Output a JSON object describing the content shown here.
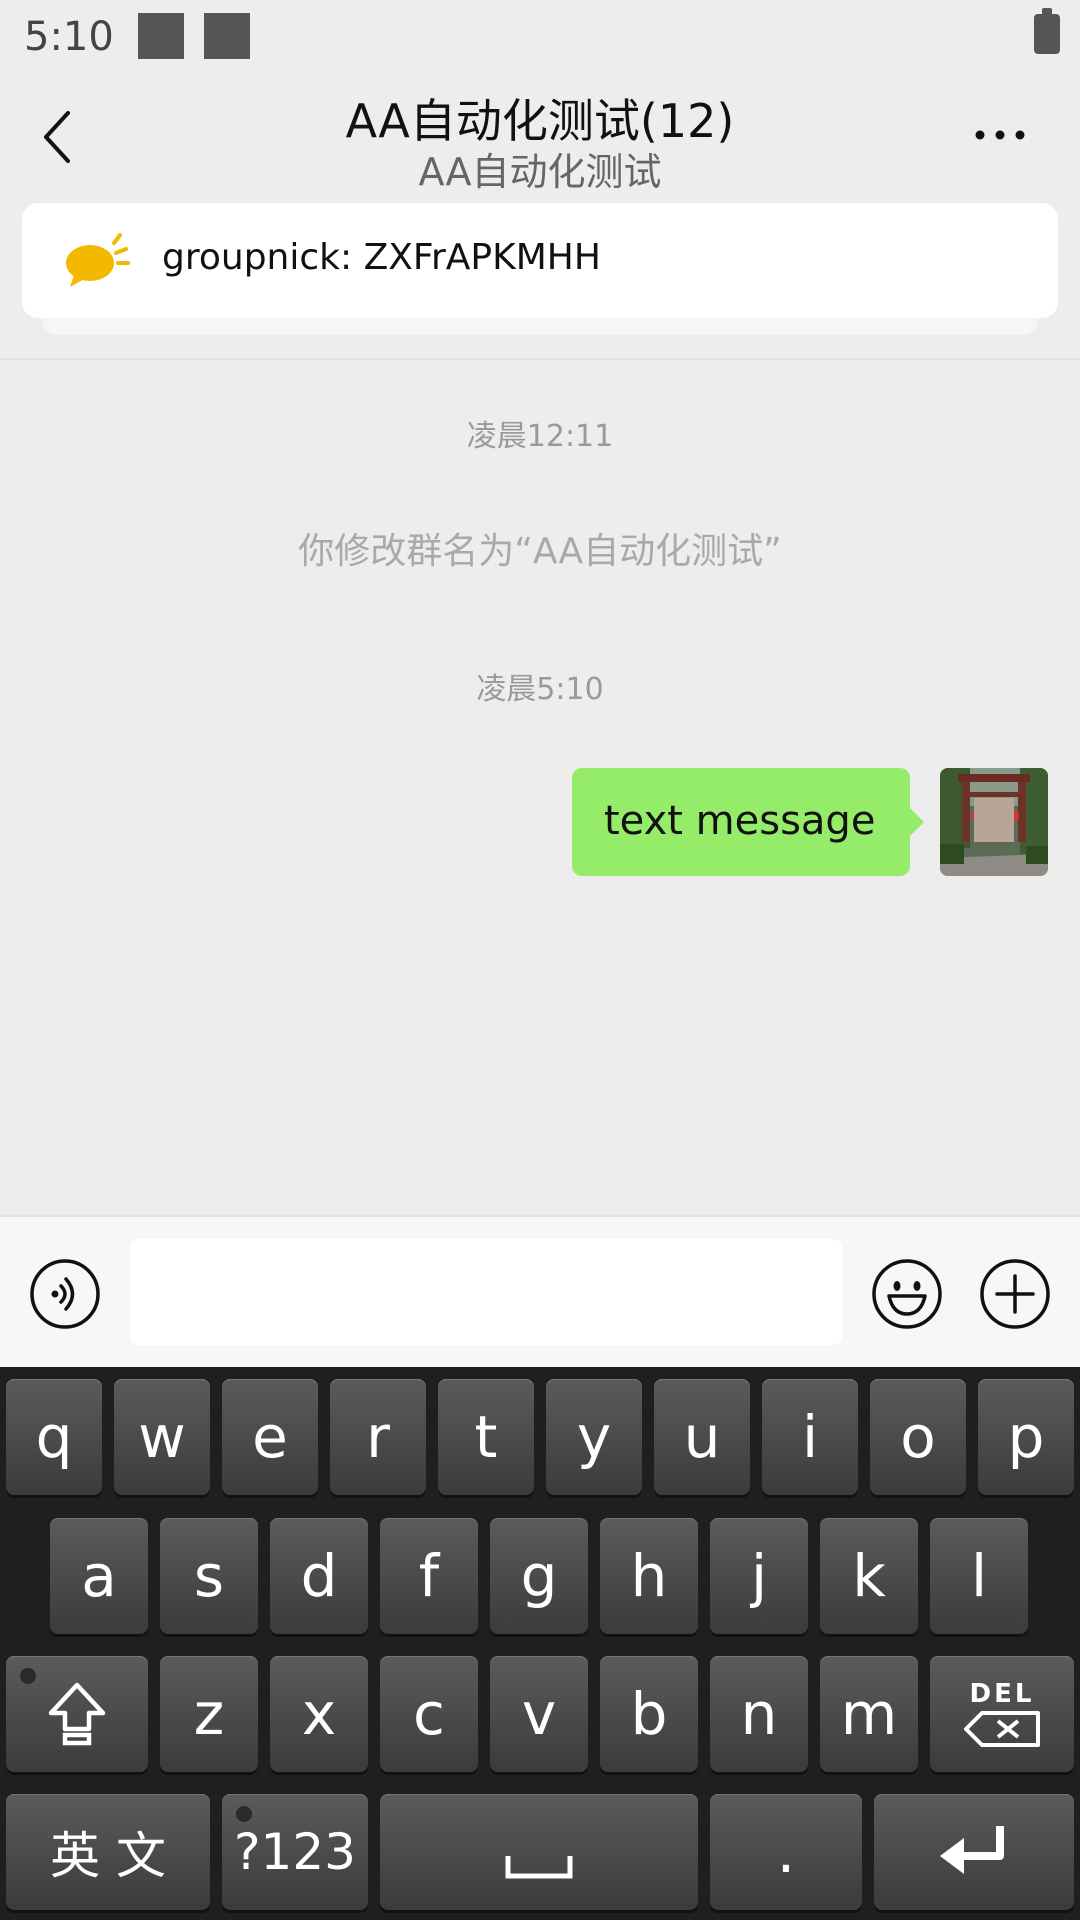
{
  "status_bar": {
    "time": "5:10"
  },
  "nav": {
    "title": "AA自动化测试(12)",
    "subtitle": "AA自动化测试"
  },
  "notice": {
    "text": "groupnick: ZXFrAPKMHH"
  },
  "chat": {
    "time1": "凌晨12:11",
    "system_message": "你修改群名为“AA自动化测试”",
    "time2": "凌晨5:10",
    "message_text": "text message"
  },
  "input": {
    "value": "",
    "placeholder": ""
  },
  "keyboard": {
    "row1": [
      "q",
      "w",
      "e",
      "r",
      "t",
      "y",
      "u",
      "i",
      "o",
      "p"
    ],
    "row2": [
      "a",
      "s",
      "d",
      "f",
      "g",
      "h",
      "j",
      "k",
      "l"
    ],
    "row3": [
      "z",
      "x",
      "c",
      "v",
      "b",
      "n",
      "m"
    ],
    "del_label": "DEL",
    "lang_label": "英 文",
    "symbols_label": "?123",
    "period_label": "."
  },
  "colors": {
    "bubble": "#95ec69",
    "background": "#ededed",
    "notice_icon": "#f5b800"
  }
}
